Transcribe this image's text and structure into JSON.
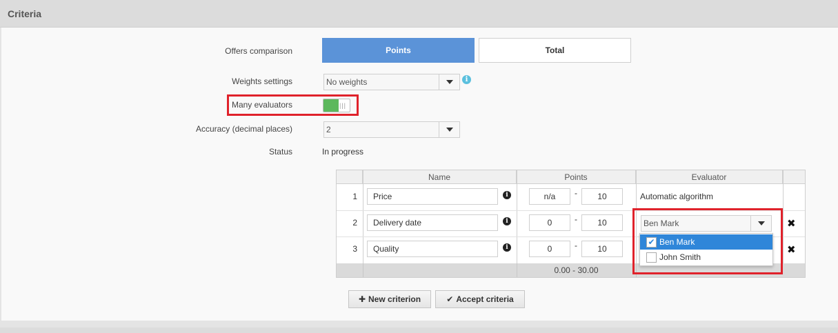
{
  "panel": {
    "title": "Criteria"
  },
  "form": {
    "offers_label": "Offers comparison",
    "offers_options": [
      "Points",
      "Total"
    ],
    "offers_selected": "Points",
    "weights_label": "Weights settings",
    "weights_value": "No weights",
    "evaluators_label": "Many evaluators",
    "evaluators_enabled": true,
    "accuracy_label": "Accuracy (decimal places)",
    "accuracy_value": "2",
    "status_label": "Status",
    "status_value": "In progress"
  },
  "table": {
    "headers": {
      "name": "Name",
      "points": "Points",
      "evaluator": "Evaluator"
    },
    "rows": [
      {
        "num": "1",
        "name": "Price",
        "min": "n/a",
        "max": "10",
        "evaluator": "Automatic algorithm"
      },
      {
        "num": "2",
        "name": "Delivery date",
        "min": "0",
        "max": "10",
        "evaluator": "Ben Mark"
      },
      {
        "num": "3",
        "name": "Quality",
        "min": "0",
        "max": "10",
        "evaluator": ""
      }
    ],
    "dash": "-",
    "total": "0.00 - 30.00"
  },
  "evaluator_dropdown": {
    "options": [
      {
        "label": "Ben Mark",
        "checked": true
      },
      {
        "label": "John Smith",
        "checked": false
      }
    ]
  },
  "actions": {
    "new_criterion": "New criterion",
    "accept_criteria": "Accept criteria"
  },
  "colors": {
    "primary": "#5b93d8",
    "toggle_on": "#5cb85c",
    "highlight": "#e0222b",
    "selection": "#2f86d9"
  }
}
